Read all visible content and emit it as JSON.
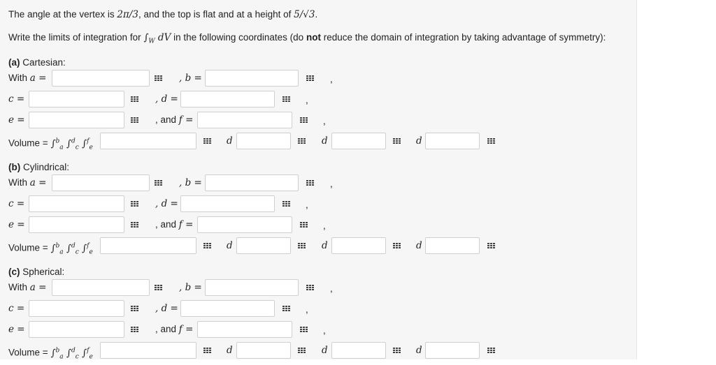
{
  "intro": {
    "line1_pre": "The angle at the vertex is ",
    "line1_angle": "2π/3",
    "line1_mid": ", and the top is flat and at a height of ",
    "line1_height": "5/√3",
    "line1_post": ".",
    "line2_pre": "Write the limits of integration for ",
    "line2_integral": "∫",
    "line2_sub": "W",
    "line2_dv": " dV",
    "line2_mid": " in the following coordinates (do ",
    "line2_not": "not",
    "line2_post": " reduce the domain of integration by taking advantage of symmetry):"
  },
  "sections": [
    {
      "tag": "(a)",
      "name": " Cartesian:"
    },
    {
      "tag": "(b)",
      "name": " Cylindrical:"
    },
    {
      "tag": "(c)",
      "name": " Spherical:"
    }
  ],
  "labels": {
    "with_a": "With",
    "a_eq": "a =",
    "b_eq": ", b =",
    "c_eq": "c =",
    "d_eq": ", d =",
    "e_eq": "e =",
    "and_f": ", and",
    "f_eq": "f =",
    "comma": ",",
    "volume": "Volume =",
    "d": "d",
    "int_b": "b",
    "int_a": "a",
    "int_d": "d",
    "int_c": "c",
    "int_f": "f",
    "int_e": "e"
  },
  "icons": {
    "matrix": "matrix-grid-icon"
  }
}
